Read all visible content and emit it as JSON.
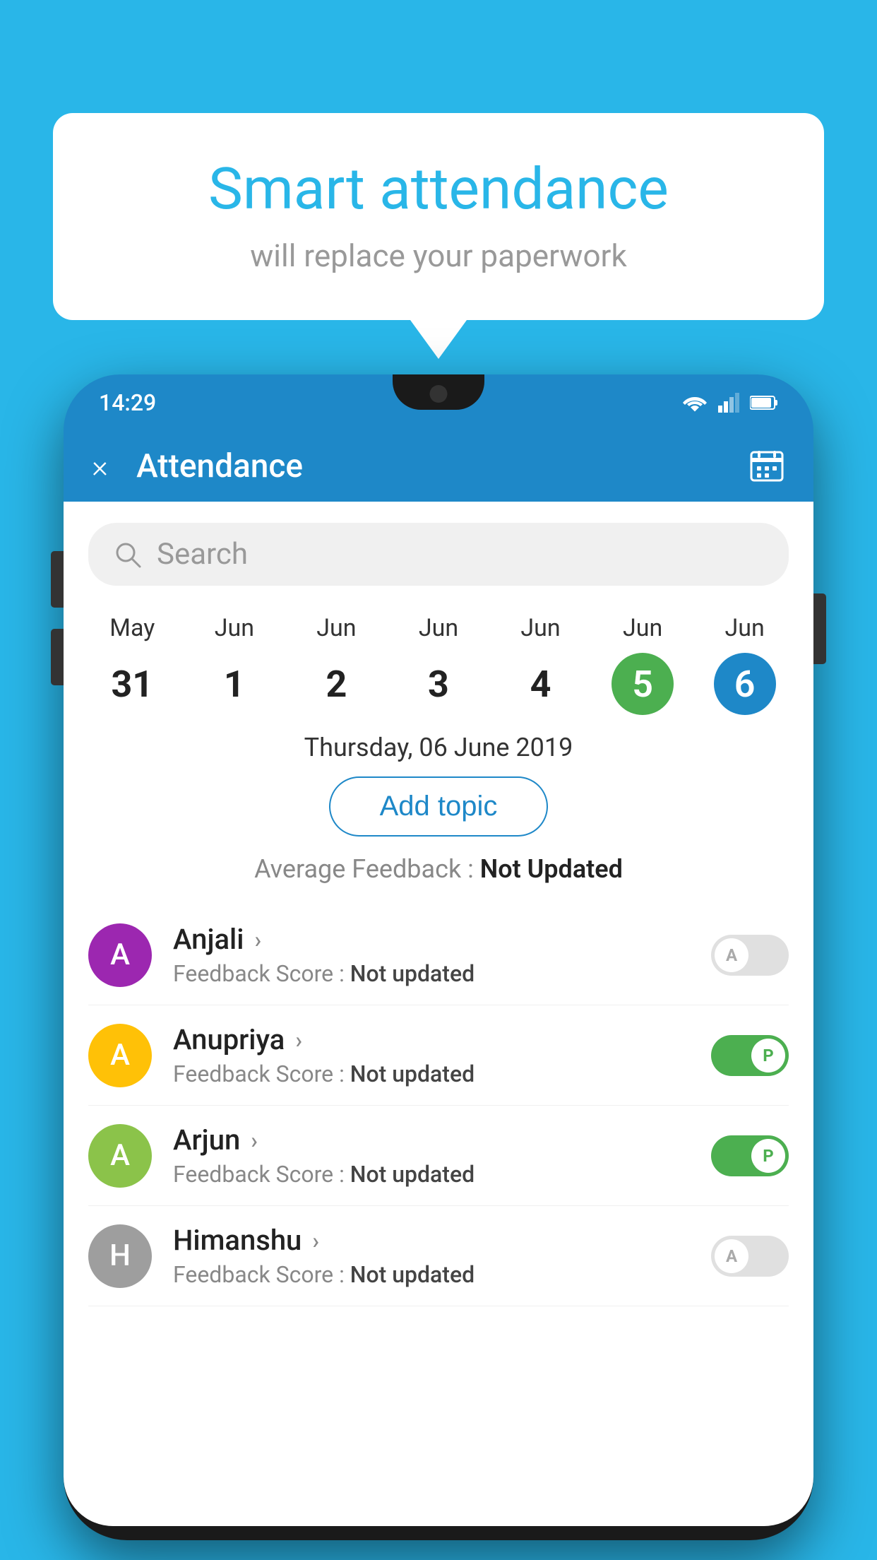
{
  "background_color": "#29B6E8",
  "speech_bubble": {
    "title": "Smart attendance",
    "subtitle": "will replace your paperwork"
  },
  "status_bar": {
    "time": "14:29"
  },
  "app_header": {
    "title": "Attendance",
    "close_label": "×",
    "calendar_icon": "calendar-icon"
  },
  "search": {
    "placeholder": "Search"
  },
  "calendar": {
    "days": [
      {
        "month": "May",
        "number": "31",
        "style": "normal"
      },
      {
        "month": "Jun",
        "number": "1",
        "style": "normal"
      },
      {
        "month": "Jun",
        "number": "2",
        "style": "normal"
      },
      {
        "month": "Jun",
        "number": "3",
        "style": "normal"
      },
      {
        "month": "Jun",
        "number": "4",
        "style": "normal"
      },
      {
        "month": "Jun",
        "number": "5",
        "style": "green"
      },
      {
        "month": "Jun",
        "number": "6",
        "style": "blue"
      }
    ]
  },
  "selected_date": "Thursday, 06 June 2019",
  "add_topic_label": "Add topic",
  "avg_feedback": {
    "label": "Average Feedback : ",
    "value": "Not Updated"
  },
  "students": [
    {
      "name": "Anjali",
      "avatar_letter": "A",
      "avatar_color": "#9C27B0",
      "feedback_label": "Feedback Score : ",
      "feedback_value": "Not updated",
      "toggle": "off",
      "toggle_letter": "A"
    },
    {
      "name": "Anupriya",
      "avatar_letter": "A",
      "avatar_color": "#FFC107",
      "feedback_label": "Feedback Score : ",
      "feedback_value": "Not updated",
      "toggle": "on",
      "toggle_letter": "P"
    },
    {
      "name": "Arjun",
      "avatar_letter": "A",
      "avatar_color": "#8BC34A",
      "feedback_label": "Feedback Score : ",
      "feedback_value": "Not updated",
      "toggle": "on",
      "toggle_letter": "P"
    },
    {
      "name": "Himanshu",
      "avatar_letter": "H",
      "avatar_color": "#9E9E9E",
      "feedback_label": "Feedback Score : ",
      "feedback_value": "Not updated",
      "toggle": "off",
      "toggle_letter": "A"
    }
  ]
}
